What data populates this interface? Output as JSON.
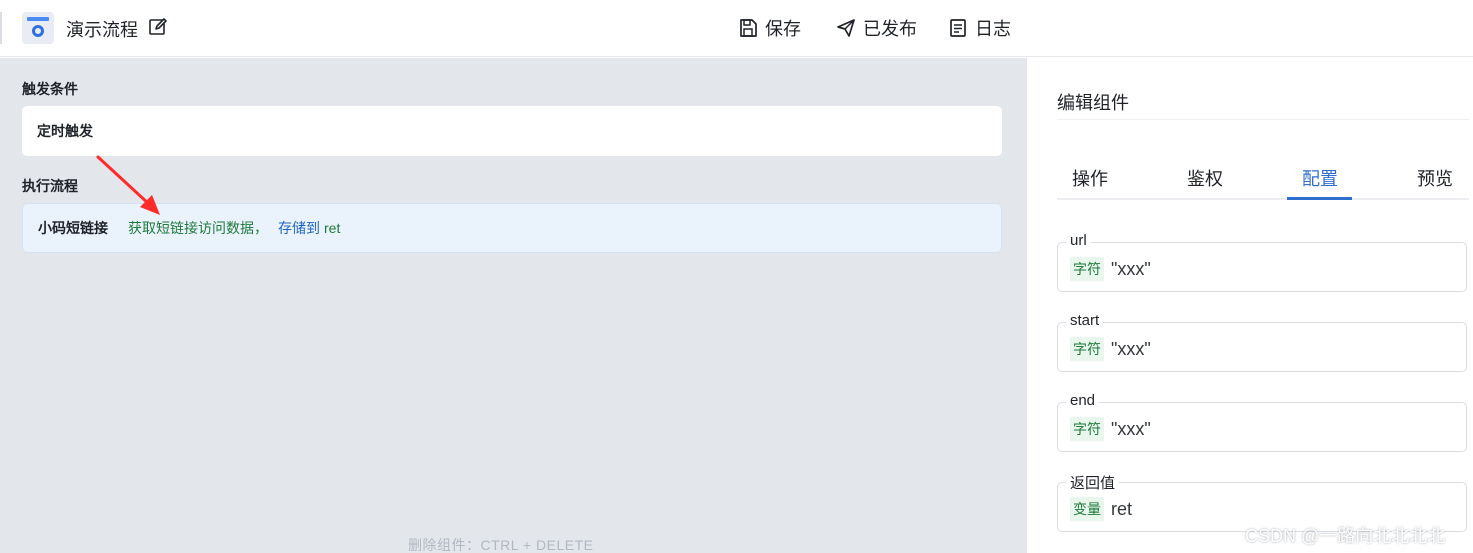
{
  "header": {
    "app_title": "演示流程",
    "toolbar": {
      "save_label": "保存",
      "publish_label": "已发布",
      "log_label": "日志"
    }
  },
  "main": {
    "trigger_section_label": "触发条件",
    "trigger_card_label": "定时触发",
    "flow_section_label": "执行流程",
    "flow_step": {
      "name": "小码短链接",
      "action": "获取短链接访问数据，",
      "store_label": "存储到",
      "variable": "ret"
    },
    "hint": "删除组件：CTRL + DELETE"
  },
  "panel": {
    "title": "编辑组件",
    "tabs": [
      {
        "label": "操作",
        "active": false
      },
      {
        "label": "鉴权",
        "active": false
      },
      {
        "label": "配置",
        "active": true
      },
      {
        "label": "预览",
        "active": false
      }
    ],
    "fields": [
      {
        "label": "url",
        "type_tag": "字符",
        "value": "\"xxx\""
      },
      {
        "label": "start",
        "type_tag": "字符",
        "value": "\"xxx\""
      },
      {
        "label": "end",
        "type_tag": "字符",
        "value": "\"xxx\""
      },
      {
        "label": "返回值",
        "type_tag": "变量",
        "value": "ret"
      }
    ]
  },
  "watermark": "CSDN @一路向北北北北",
  "colors": {
    "accent": "#2f6fd0",
    "action_green": "#1f7a3b",
    "canvas_bg": "#e3e6eb",
    "flow_card_bg": "#eaf2fc",
    "annotation_arrow": "#ff2a2a"
  }
}
